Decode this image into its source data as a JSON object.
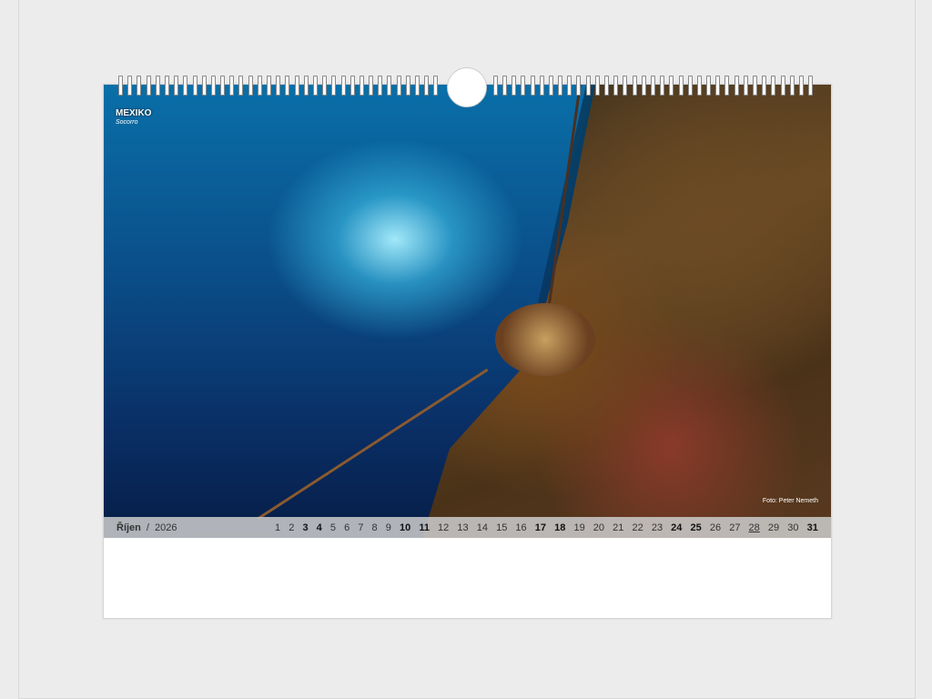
{
  "calendar": {
    "location_title": "MEXIKO",
    "location_subtitle": "Socorro",
    "photo_credit": "Foto: Peter Nemeth",
    "month": "Říjen",
    "separator": "/",
    "year": "2026",
    "days": [
      {
        "n": "1"
      },
      {
        "n": "2"
      },
      {
        "n": "3",
        "bold": true
      },
      {
        "n": "4",
        "bold": true
      },
      {
        "n": "5"
      },
      {
        "n": "6"
      },
      {
        "n": "7"
      },
      {
        "n": "8"
      },
      {
        "n": "9"
      },
      {
        "n": "10",
        "bold": true
      },
      {
        "n": "11",
        "bold": true
      },
      {
        "n": "12"
      },
      {
        "n": "13"
      },
      {
        "n": "14"
      },
      {
        "n": "15"
      },
      {
        "n": "16"
      },
      {
        "n": "17",
        "bold": true
      },
      {
        "n": "18",
        "bold": true
      },
      {
        "n": "19"
      },
      {
        "n": "20"
      },
      {
        "n": "21"
      },
      {
        "n": "22"
      },
      {
        "n": "23"
      },
      {
        "n": "24",
        "bold": true
      },
      {
        "n": "25",
        "bold": true
      },
      {
        "n": "26"
      },
      {
        "n": "27"
      },
      {
        "n": "28",
        "holiday": true
      },
      {
        "n": "29"
      },
      {
        "n": "30"
      },
      {
        "n": "31",
        "bold": true
      }
    ]
  }
}
